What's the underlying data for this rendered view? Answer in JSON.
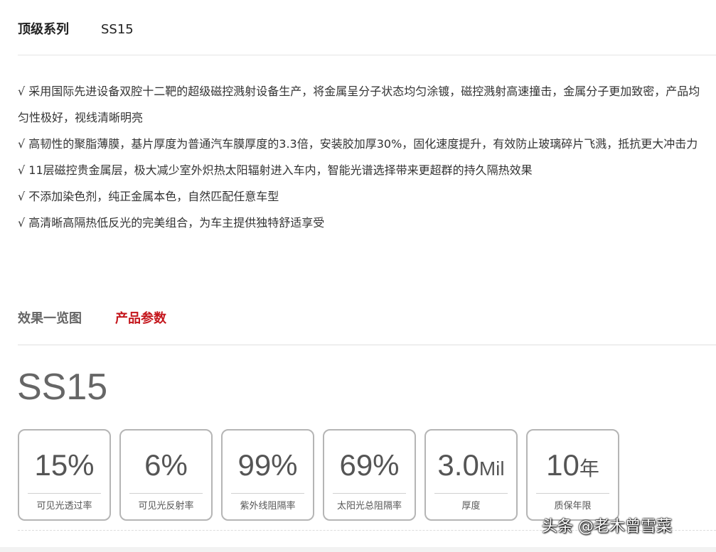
{
  "header": {
    "series_label": "顶级系列",
    "product_name": "SS15"
  },
  "features": [
    "√ 采用国际先进设备双腔十二靶的超级磁控溅射设备生产，将金属呈分子状态均匀涂镀，磁控溅射高速撞击，金属分子更加致密，产品均匀性极好，视线清晰明亮",
    "√ 高韧性的聚脂薄膜，基片厚度为普通汽车膜厚度的3.3倍，安装胶加厚30%，固化速度提升，有效防止玻璃碎片飞溅，抵抗更大冲击力",
    "√ 11层磁控贵金属层，极大减少室外炽热太阳辐射进入车内，智能光谱选择带来更超群的持久隔热效果",
    "√ 不添加染色剂，纯正金属本色，自然匹配任意车型",
    "√ 高清晰高隔热低反光的完美组合，为车主提供独特舒适享受"
  ],
  "tabs": {
    "effects": "效果一览图",
    "params": "产品参数",
    "active": "params"
  },
  "params": {
    "title": "SS15",
    "specs": [
      {
        "value": "15%",
        "unit": "",
        "label": "可见光透过率"
      },
      {
        "value": "6%",
        "unit": "",
        "label": "可见光反射率"
      },
      {
        "value": "99%",
        "unit": "",
        "label": "紫外线阻隔率"
      },
      {
        "value": "69%",
        "unit": "",
        "label": "太阳光总阻隔率"
      },
      {
        "value": "3.0",
        "unit": "Mil",
        "label": "厚度"
      },
      {
        "value": "10",
        "unit": "年",
        "label": "质保年限"
      }
    ]
  },
  "watermark": "头条 @老木曾雪菜",
  "colors": {
    "accent": "#c4161c",
    "text": "#333333",
    "muted": "#666666",
    "card_border": "#b5b5b5"
  }
}
